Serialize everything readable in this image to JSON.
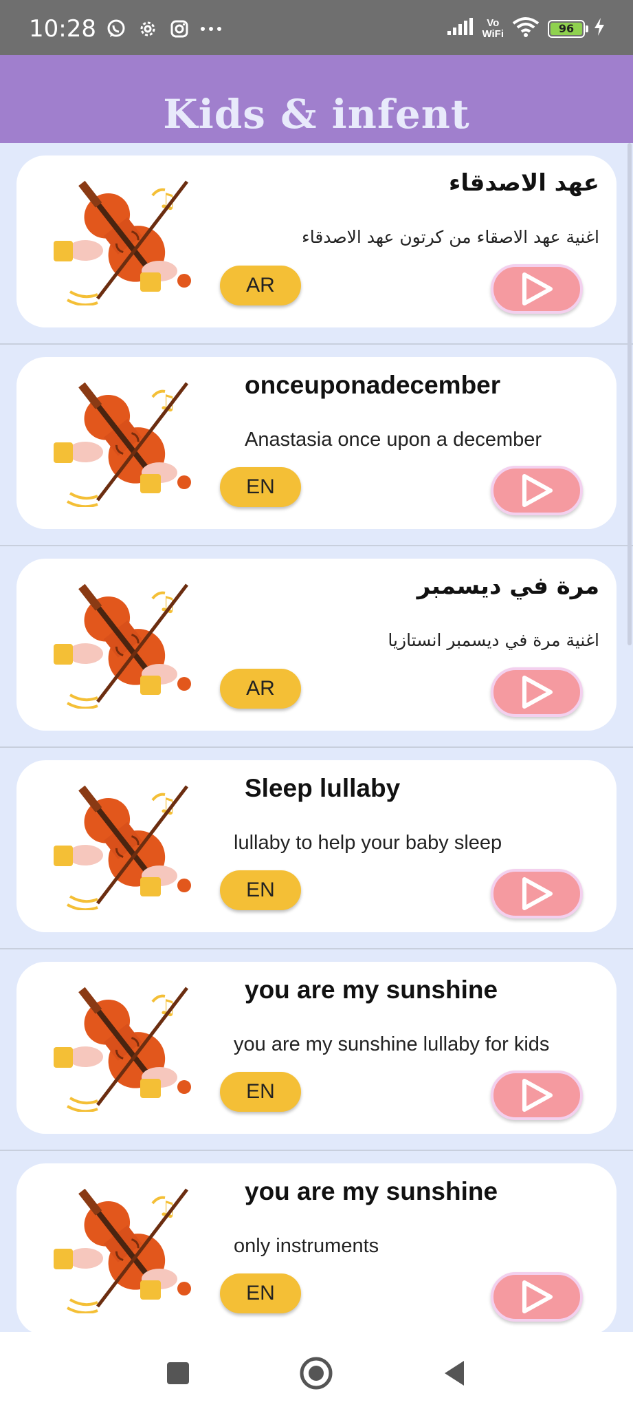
{
  "status_bar": {
    "time": "10:28",
    "left_icons": [
      "whatsapp-icon",
      "settings-gear-icon",
      "instagram-icon",
      "more-dots-icon"
    ],
    "vowifi_line1": "Vo",
    "vowifi_line2": "WiFi",
    "battery_level": "96",
    "battery_percent": 96
  },
  "app_bar": {
    "title": "Kids & infent",
    "color": "#a07fcd"
  },
  "songs": [
    {
      "title": "عهد الاصدقاء",
      "description": "اغنية عهد الاصقاء من كرتون عهد الاصدقاء",
      "lang": "AR",
      "rtl": true
    },
    {
      "title": "onceuponadecember",
      "description": "Anastasia once upon a december",
      "lang": "EN",
      "rtl": false
    },
    {
      "title": "مرة في ديسمبر",
      "description": "اغنية مرة في ديسمبر انستازيا",
      "lang": "AR",
      "rtl": true
    },
    {
      "title": "Sleep lullaby",
      "description": "lullaby to help your baby sleep",
      "lang": "EN",
      "rtl": false
    },
    {
      "title": "you are my sunshine",
      "description": "you are my sunshine lullaby for kids",
      "lang": "EN",
      "rtl": false
    },
    {
      "title": "you are my sunshine",
      "description": "only instruments",
      "lang": "EN",
      "rtl": false
    }
  ],
  "colors": {
    "lang_badge": "#f4bf36",
    "play_button": "#f59aa0",
    "background": "#e1e9fb"
  },
  "nav": {
    "icons": [
      "recents-square-icon",
      "home-circle-icon",
      "back-triangle-icon"
    ]
  }
}
